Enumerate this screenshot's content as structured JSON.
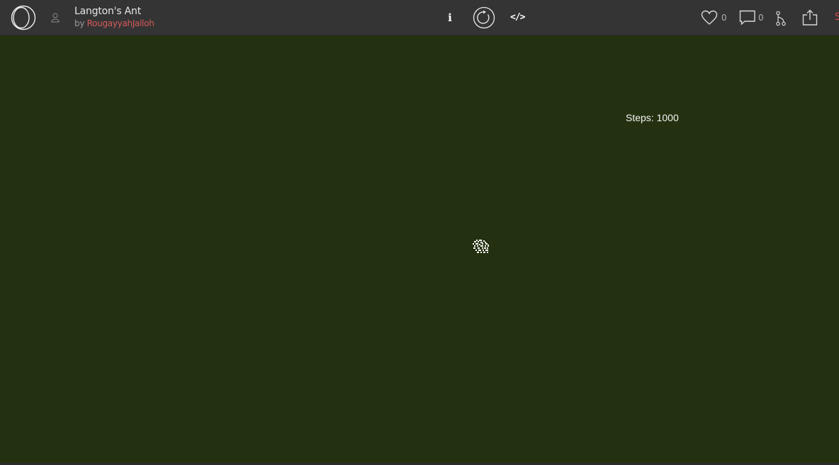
{
  "header": {
    "title": "Langton's Ant",
    "by_prefix": "by ",
    "author": "RougayyahJalloh",
    "info_label": "i",
    "code_label": "</>",
    "likes": "0",
    "comments": "0",
    "edge_label": "S"
  },
  "canvas": {
    "steps_text": "Steps: 1000"
  },
  "colors": {
    "topbar": "#343434",
    "canvas_bg": "#243110",
    "author": "#d65a5a",
    "edge_accent": "#d64a4a"
  },
  "icons": [
    "logo-icon",
    "user-icon",
    "info-icon",
    "reload-icon",
    "code-icon",
    "heart-icon",
    "comment-icon",
    "fork-icon",
    "share-icon"
  ]
}
